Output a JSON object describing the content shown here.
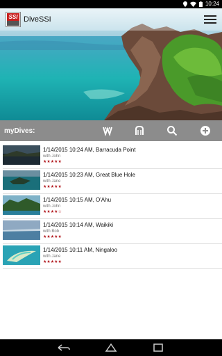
{
  "status_bar": {
    "time": "10:24"
  },
  "app": {
    "title": "DiveSSI",
    "logo_text": "SSI"
  },
  "toolbar": {
    "label": "myDives:",
    "icons": [
      "dive-sites-icon",
      "dive-buddies-icon",
      "search-icon",
      "add-icon"
    ]
  },
  "dives": [
    {
      "title": "1/14/2015 10:24 AM, Barracuda Point",
      "with": "with John",
      "stars": "★★★★★",
      "rating": 5
    },
    {
      "title": "1/14/2015 10:23 AM, Great Blue Hole",
      "with": "with Jane",
      "stars": "★★★★★",
      "rating": 5
    },
    {
      "title": "1/14/2015 10:15 AM, O'Ahu",
      "with": "with John",
      "stars": "★★★★☆",
      "rating": 4
    },
    {
      "title": "1/14/2015 10:14 AM, Waikiki",
      "with": "with Bob",
      "stars": "★★★★★",
      "rating": 5
    },
    {
      "title": "1/14/2015 10:11 AM, Ningaloo",
      "with": "with Jane",
      "stars": "★★★★★",
      "rating": 5
    }
  ],
  "colors": {
    "toolbar": "#8c8c8c",
    "stars": "#b0151b",
    "brand": "#c8201f"
  }
}
